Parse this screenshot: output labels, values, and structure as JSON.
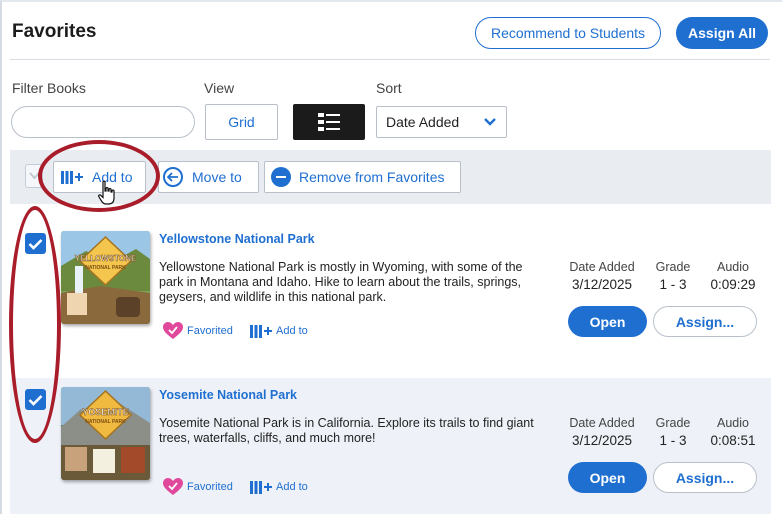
{
  "page": {
    "title": "Favorites"
  },
  "header": {
    "recommend_label": "Recommend to Students",
    "assign_all_label": "Assign All"
  },
  "filters": {
    "filter_label": "Filter Books",
    "filter_value": "",
    "filter_placeholder": "",
    "view_label": "View",
    "grid_label": "Grid",
    "list_icon": "list-view-icon",
    "sort_label": "Sort",
    "sort_value": "Date Added"
  },
  "action_bar": {
    "add_to_label": "Add to",
    "move_to_label": "Move to",
    "remove_label": "Remove from Favorites"
  },
  "books": [
    {
      "title": "Yellowstone National Park",
      "description": "Yellowstone National Park is mostly in Wyoming, with some of the park in Montana and Idaho. Hike to learn about the trails, springs, geysers, and wildlife in this national park.",
      "cover_title": "YELLOWSTONE",
      "cover_subtitle": "NATIONAL PARK",
      "date_added_label": "Date Added",
      "date_added": "3/12/2025",
      "grade_label": "Grade",
      "grade": "1 - 3",
      "audio_label": "Audio",
      "audio": "0:09:29",
      "open_label": "Open",
      "assign_label": "Assign...",
      "favorited_label": "Favorited",
      "add_to_label": "Add to",
      "checked": true
    },
    {
      "title": "Yosemite National Park",
      "description": "Yosemite National Park is in California. Explore its trails to find giant trees, waterfalls, cliffs, and much more!",
      "cover_title": "YOSEMITE",
      "cover_subtitle": "NATIONAL PARK",
      "date_added_label": "Date Added",
      "date_added": "3/12/2025",
      "grade_label": "Grade",
      "grade": "1 - 3",
      "audio_label": "Audio",
      "audio": "0:08:51",
      "open_label": "Open",
      "assign_label": "Assign...",
      "favorited_label": "Favorited",
      "add_to_label": "Add to",
      "checked": true
    }
  ],
  "colors": {
    "accent": "#1f6fd1",
    "annotation": "#a91d2a",
    "favorite": "#e0489b"
  }
}
